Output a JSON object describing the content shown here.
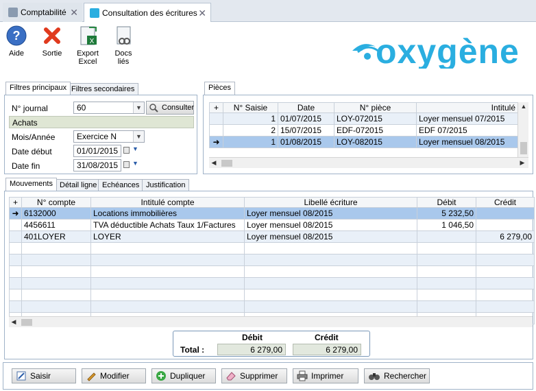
{
  "tabs": [
    {
      "label": "Comptabilité",
      "close": "✕"
    },
    {
      "label": "Consultation des écritures",
      "close": "✕"
    }
  ],
  "toolbar": {
    "help": "Aide",
    "exit": "Sortie",
    "export_line1": "Export",
    "export_line2": "Excel",
    "docs_line1": "Docs",
    "docs_line2": "liés"
  },
  "logo": {
    "text": "oxygène",
    "color": "#2aaee0"
  },
  "filters": {
    "tab_main": "Filtres principaux",
    "tab_secondary": "Filtres secondaires",
    "journal_label": "N° journal",
    "journal_value": "60",
    "consult_label": "Consulter",
    "journal_name": "Achats",
    "period_label": "Mois/Année",
    "period_value": "Exercice N",
    "start_label": "Date début",
    "start_value": "01/01/2015",
    "end_label": "Date fin",
    "end_value": "31/08/2015"
  },
  "pieces": {
    "tab": "Pièces",
    "columns": [
      "N° Saisie",
      "Date",
      "N° pièce",
      "Intitulé"
    ],
    "rows": [
      {
        "saisie": "1",
        "date": "01/07/2015",
        "piece": "LOY-072015",
        "intitule": "Loyer mensuel 07/2015"
      },
      {
        "saisie": "2",
        "date": "15/07/2015",
        "piece": "EDF-072015",
        "intitule": "EDF 07/2015"
      },
      {
        "saisie": "1",
        "date": "01/08/2015",
        "piece": "LOY-082015",
        "intitule": "Loyer mensuel 08/2015"
      }
    ]
  },
  "details": {
    "tabs": [
      "Mouvements",
      "Détail ligne",
      "Echéances",
      "Justification"
    ],
    "columns": [
      "N° compte",
      "Intitulé compte",
      "Libellé écriture",
      "Débit",
      "Crédit"
    ],
    "rows": [
      {
        "compte": "6132000",
        "intitule": "Locations immobilières",
        "libelle": "Loyer mensuel 08/2015",
        "debit": "5 232,50",
        "credit": ""
      },
      {
        "compte": "4456611",
        "intitule": "TVA déductible Achats Taux 1/Factures",
        "libelle": "Loyer mensuel 08/2015",
        "debit": "1 046,50",
        "credit": ""
      },
      {
        "compte": "401LOYER",
        "intitule": "LOYER",
        "libelle": "Loyer mensuel 08/2015",
        "debit": "",
        "credit": "6 279,00"
      }
    ]
  },
  "totals": {
    "debit_label": "Débit",
    "credit_label": "Crédit",
    "total_label": "Total :",
    "debit_value": "6 279,00",
    "credit_value": "6 279,00"
  },
  "actions": {
    "saisir": "Saisir",
    "modifier": "Modifier",
    "dupliquer": "Dupliquer",
    "supprimer": "Supprimer",
    "imprimer": "Imprimer",
    "rechercher": "Rechercher"
  }
}
